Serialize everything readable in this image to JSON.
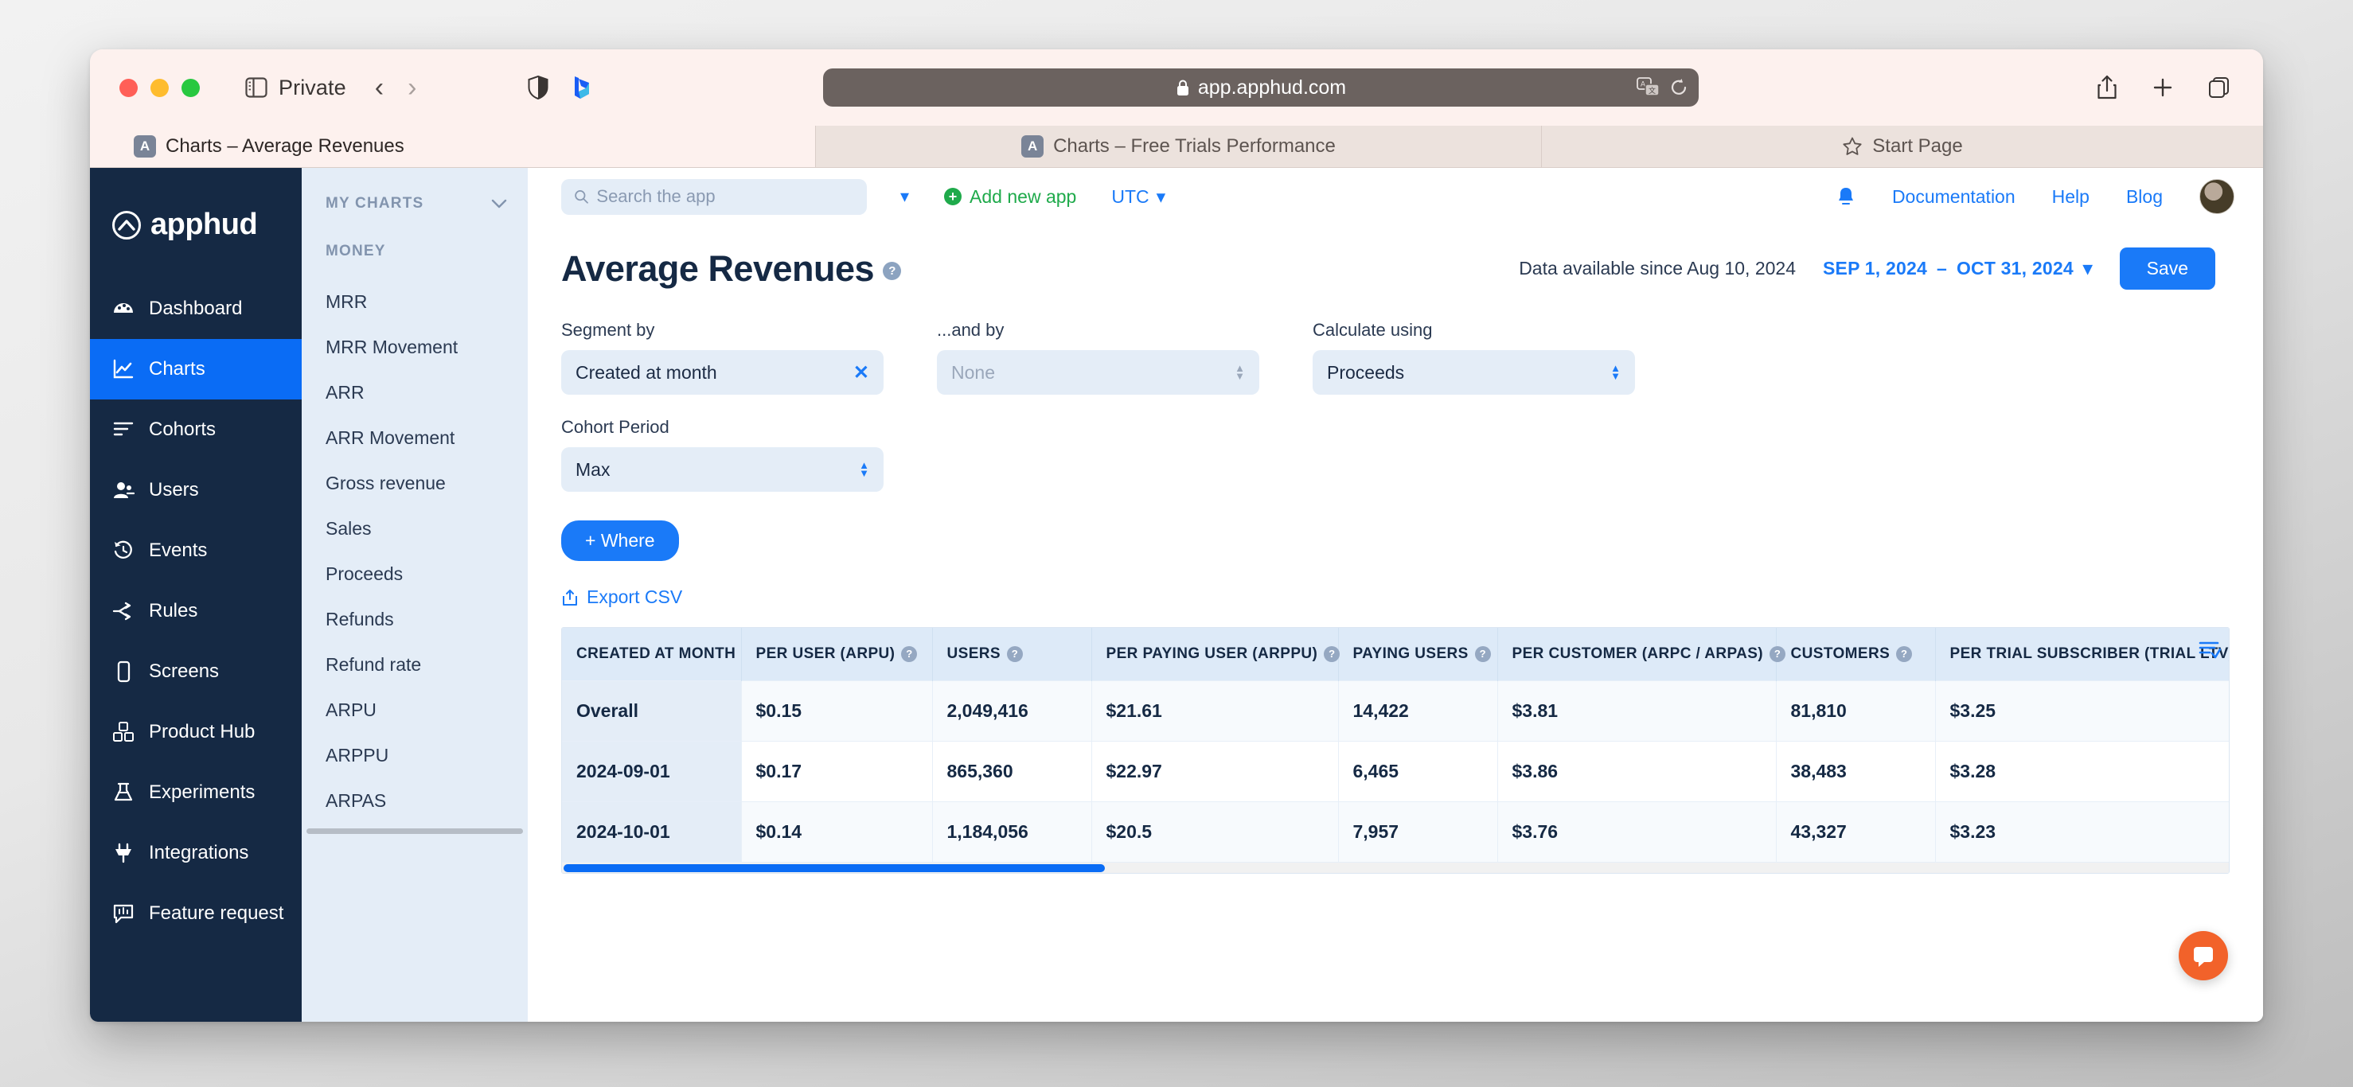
{
  "browser": {
    "profile_label": "Private",
    "url": "app.apphud.com",
    "icons": {
      "sidebar_toggle": "sidebar-toggle-icon",
      "back": "back-chevron-icon",
      "forward": "forward-chevron-icon",
      "shield": "privacy-shield-icon",
      "bing": "bing-copilot-icon",
      "lock": "lock-icon",
      "translate": "translate-icon",
      "reload": "reload-icon",
      "share": "share-icon",
      "new_tab": "plus-icon",
      "tab_overview": "tab-overview-icon"
    },
    "tabs": [
      {
        "favicon": "A",
        "title": "Charts – Average Revenues",
        "active": true
      },
      {
        "favicon": "A",
        "title": "Charts – Free Trials Performance",
        "active": false
      },
      {
        "favicon": "star",
        "title": "Start Page",
        "active": false
      }
    ]
  },
  "sidebar": {
    "brand": "apphud",
    "items": [
      {
        "label": "Dashboard",
        "icon": "dashboard-icon",
        "active": false
      },
      {
        "label": "Charts",
        "icon": "charts-icon",
        "active": true
      },
      {
        "label": "Cohorts",
        "icon": "cohorts-icon",
        "active": false
      },
      {
        "label": "Users",
        "icon": "users-icon",
        "active": false
      },
      {
        "label": "Events",
        "icon": "events-icon",
        "active": false
      },
      {
        "label": "Rules",
        "icon": "rules-icon",
        "active": false
      },
      {
        "label": "Screens",
        "icon": "screens-icon",
        "active": false
      },
      {
        "label": "Product Hub",
        "icon": "product-hub-icon",
        "active": false
      },
      {
        "label": "Experiments",
        "icon": "experiments-icon",
        "active": false
      },
      {
        "label": "Integrations",
        "icon": "integrations-icon",
        "active": false
      },
      {
        "label": "Feature request",
        "icon": "feature-request-icon",
        "active": false
      }
    ]
  },
  "charts_panel": {
    "header": "MY CHARTS",
    "group_label": "MONEY",
    "items": [
      "MRR",
      "MRR Movement",
      "ARR",
      "ARR Movement",
      "Gross revenue",
      "Sales",
      "Proceeds",
      "Refunds",
      "Refund rate",
      "ARPU",
      "ARPPU",
      "ARPAS"
    ]
  },
  "appbar": {
    "search_placeholder": "Search the app",
    "search_value": "",
    "add_new_app": "Add new app",
    "timezone": "UTC",
    "documentation": "Documentation",
    "help": "Help",
    "blog": "Blog"
  },
  "header": {
    "title": "Average Revenues",
    "data_available": "Data available since Aug 10, 2024",
    "date_from": "SEP 1, 2024",
    "date_sep": "–",
    "date_to": "OCT 31, 2024",
    "save_label": "Save"
  },
  "filters": {
    "segment_by_label": "Segment by",
    "segment_by_value": "Created at month",
    "and_by_label": "...and by",
    "and_by_value": "None",
    "calculate_using_label": "Calculate using",
    "calculate_using_value": "Proceeds",
    "cohort_period_label": "Cohort Period",
    "cohort_period_value": "Max",
    "where_label": "+ Where",
    "export_label": "Export CSV"
  },
  "table": {
    "columns": [
      {
        "label": "CREATED AT MONTH",
        "help": false
      },
      {
        "label": "PER USER (ARPU)",
        "help": true
      },
      {
        "label": "USERS",
        "help": true
      },
      {
        "label": "PER PAYING USER (ARPPU)",
        "help": true
      },
      {
        "label": "PAYING USERS",
        "help": true
      },
      {
        "label": "PER CUSTOMER (ARPC / ARPAS)",
        "help": true
      },
      {
        "label": "CUSTOMERS",
        "help": true
      },
      {
        "label": "PER TRIAL SUBSCRIBER (TRIAL LTV)",
        "help": true
      }
    ],
    "rows": [
      [
        "Overall",
        "$0.15",
        "2,049,416",
        "$21.61",
        "14,422",
        "$3.81",
        "81,810",
        "$3.25"
      ],
      [
        "2024-09-01",
        "$0.17",
        "865,360",
        "$22.97",
        "6,465",
        "$3.86",
        "38,483",
        "$3.28"
      ],
      [
        "2024-10-01",
        "$0.14",
        "1,184,056",
        "$20.5",
        "7,957",
        "$3.76",
        "43,327",
        "$3.23"
      ]
    ]
  },
  "colors": {
    "accent_blue": "#1a7af8",
    "sidebar_dark": "#152944",
    "panel_blue": "#e4edf7",
    "green": "#1faa4b",
    "intercom_orange": "#f2622a"
  }
}
